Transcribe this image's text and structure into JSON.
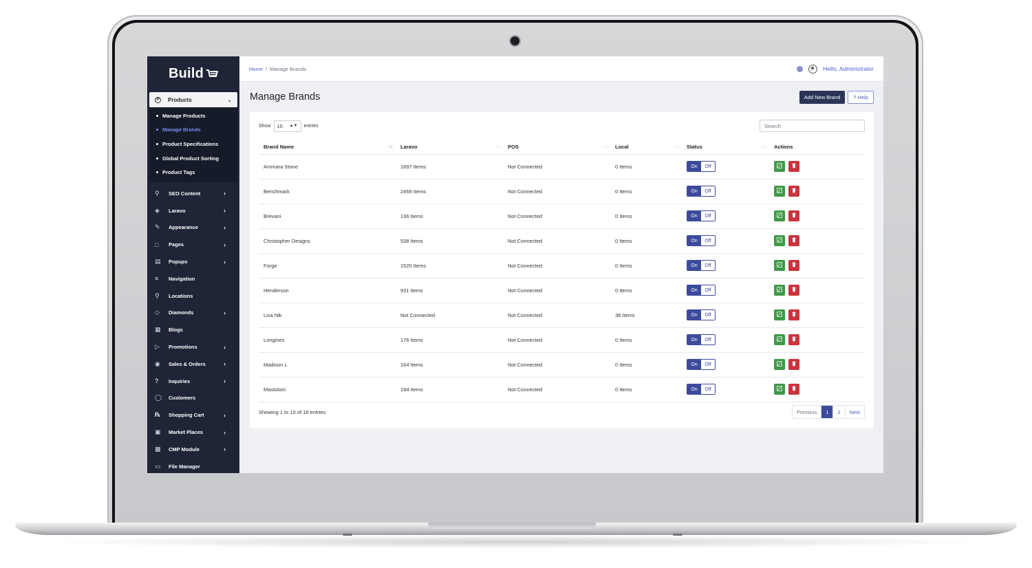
{
  "app": {
    "logo_text": "Build"
  },
  "breadcrumb": {
    "home": "Home",
    "separator": "/",
    "current": "Manage Brands"
  },
  "user": {
    "greeting": "Hello, Administrator"
  },
  "page": {
    "title": "Manage Brands",
    "add_button": "Add New Brand",
    "help_button": "? Help"
  },
  "sidebar": {
    "products": {
      "label": "Products",
      "icon": "products-icon"
    },
    "sub_items": [
      {
        "label": "Manage Products",
        "active": false
      },
      {
        "label": "Manage Brands",
        "active": true
      },
      {
        "label": "Product Specifications",
        "active": false
      },
      {
        "label": "Global Product Sorting",
        "active": false
      },
      {
        "label": "Product Tags",
        "active": false
      }
    ],
    "items": [
      {
        "label": "SEO Content",
        "icon": "seo-icon",
        "has_children": true
      },
      {
        "label": "Laravo",
        "icon": "layers-icon",
        "has_children": true
      },
      {
        "label": "Appearance",
        "icon": "brush-icon",
        "has_children": true
      },
      {
        "label": "Pages",
        "icon": "page-icon",
        "has_children": true
      },
      {
        "label": "Popups",
        "icon": "popup-icon",
        "has_children": true
      },
      {
        "label": "Navigation",
        "icon": "menu-icon",
        "has_children": false
      },
      {
        "label": "Locations",
        "icon": "location-icon",
        "has_children": false
      },
      {
        "label": "Diamonds",
        "icon": "diamond-icon",
        "has_children": true
      },
      {
        "label": "Blogs",
        "icon": "blog-icon",
        "has_children": false
      },
      {
        "label": "Promotions",
        "icon": "megaphone-icon",
        "has_children": true
      },
      {
        "label": "Sales & Orders",
        "icon": "sales-icon",
        "has_children": true
      },
      {
        "label": "Inquiries",
        "icon": "question-icon",
        "has_children": true
      },
      {
        "label": "Customers",
        "icon": "user-icon",
        "has_children": false
      },
      {
        "label": "Shopping Cart",
        "icon": "cart-icon",
        "has_children": true
      },
      {
        "label": "Market Places",
        "icon": "store-icon",
        "has_children": true
      },
      {
        "label": "CMP Module",
        "icon": "module-icon",
        "has_children": true
      },
      {
        "label": "File Manager",
        "icon": "folder-icon",
        "has_children": false
      }
    ]
  },
  "table_controls": {
    "show_label": "Show",
    "entries_value": "10",
    "entries_label": "entries",
    "search_placeholder": "Search"
  },
  "table": {
    "columns": [
      "Brand Name",
      "Laravo",
      "POS",
      "Local",
      "Status",
      "Actions"
    ],
    "rows": [
      {
        "brand": "Ammara Stone",
        "laravo": "1697 Items",
        "pos": "Not Connected",
        "local": "0 Items"
      },
      {
        "brand": "Benchmark",
        "laravo": "2469 Items",
        "pos": "Not Connected",
        "local": "0 Items"
      },
      {
        "brand": "Brevani",
        "laravo": "136 Items",
        "pos": "Not Connected",
        "local": "0 Items"
      },
      {
        "brand": "Christopher Designs",
        "laravo": "538 Items",
        "pos": "Not Connected",
        "local": "0 Items"
      },
      {
        "brand": "Forge",
        "laravo": "1520 Items",
        "pos": "Not Connected",
        "local": "0 Items"
      },
      {
        "brand": "Henderson",
        "laravo": "931 Items",
        "pos": "Not Connected",
        "local": "0 Items"
      },
      {
        "brand": "Lisa Nik",
        "laravo": "Not Connected",
        "pos": "Not Connected",
        "local": "38 Items"
      },
      {
        "brand": "Longines",
        "laravo": "176 Items",
        "pos": "Not Connected",
        "local": "0 Items"
      },
      {
        "brand": "Madison L",
        "laravo": "164 Items",
        "pos": "Not Connected",
        "local": "0 Items"
      },
      {
        "brand": "Mastoloni",
        "laravo": "194 Items",
        "pos": "Not Connected",
        "local": "0 Items"
      }
    ],
    "toggle_on": "On",
    "toggle_off": "Off"
  },
  "footer": {
    "showing": "Showing 1 to 10 of 18 entries",
    "pager": {
      "previous": "Previous",
      "pages": [
        "1",
        "2"
      ],
      "current": "1",
      "next": "Next"
    }
  },
  "colors": {
    "sidebar_bg": "#1f2537",
    "accent": "#3c4a9c",
    "edit": "#3f9a48",
    "delete": "#c9343e"
  }
}
